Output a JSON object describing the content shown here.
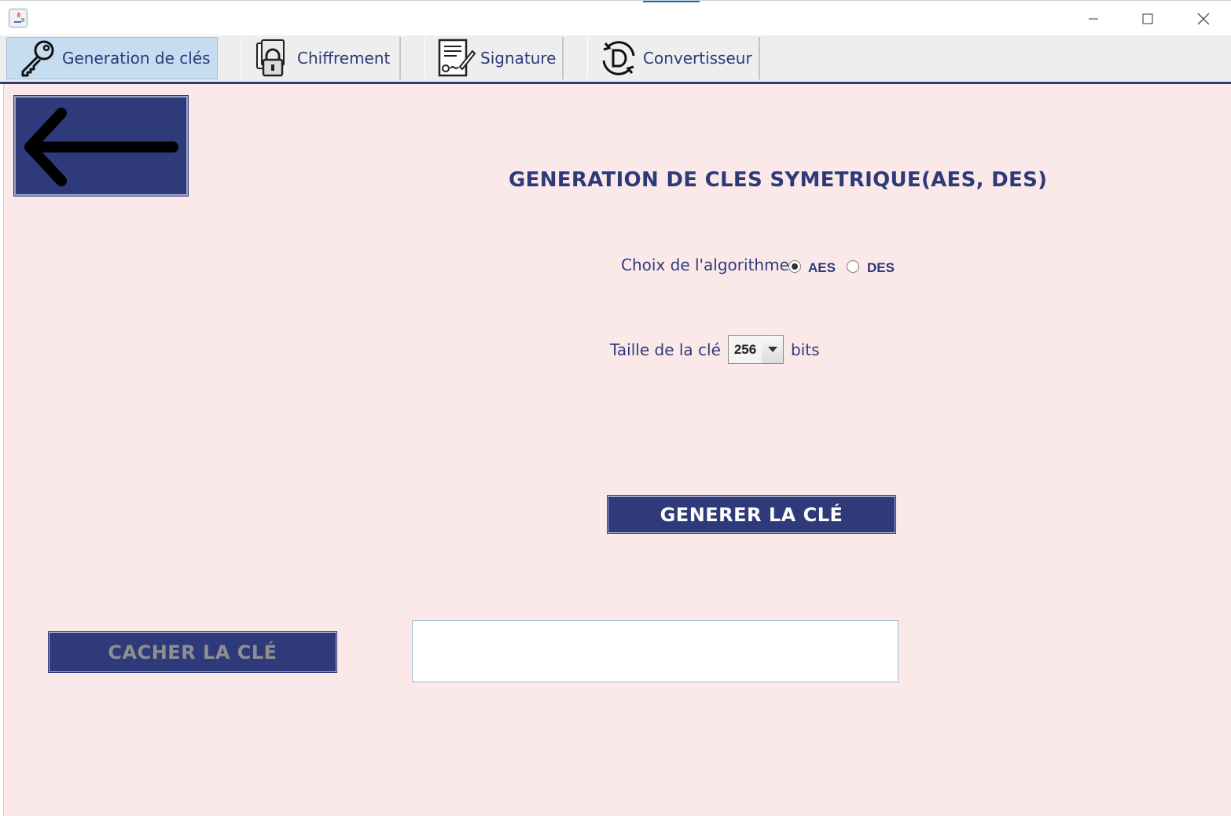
{
  "window": {
    "title": ""
  },
  "tabs": [
    {
      "label": "Generation de clés",
      "icon": "key-icon",
      "active": true
    },
    {
      "label": "Chiffrement",
      "icon": "lock-icon",
      "active": false
    },
    {
      "label": "Signature",
      "icon": "signature-icon",
      "active": false
    },
    {
      "label": "Convertisseur",
      "icon": "convert-icon",
      "active": false
    }
  ],
  "main": {
    "back_icon": "arrow-left-icon",
    "title": "GENERATION DE CLES SYMETRIQUE(AES, DES)",
    "algorithm": {
      "label": "Choix de l'algorithme",
      "options": [
        {
          "label": "AES",
          "selected": true
        },
        {
          "label": "DES",
          "selected": false
        }
      ]
    },
    "key_size": {
      "label": "Taille de la clé",
      "value": "256",
      "unit": "bits"
    },
    "generate_label": "GENERER LA CLÉ",
    "hide_label": "CACHER LA CLÉ",
    "key_output": ""
  },
  "colors": {
    "accent": "#2e3a7a",
    "background": "#fbe9ea",
    "active_tab": "#c6dcf0",
    "disabled_text": "#8f8f8f"
  }
}
